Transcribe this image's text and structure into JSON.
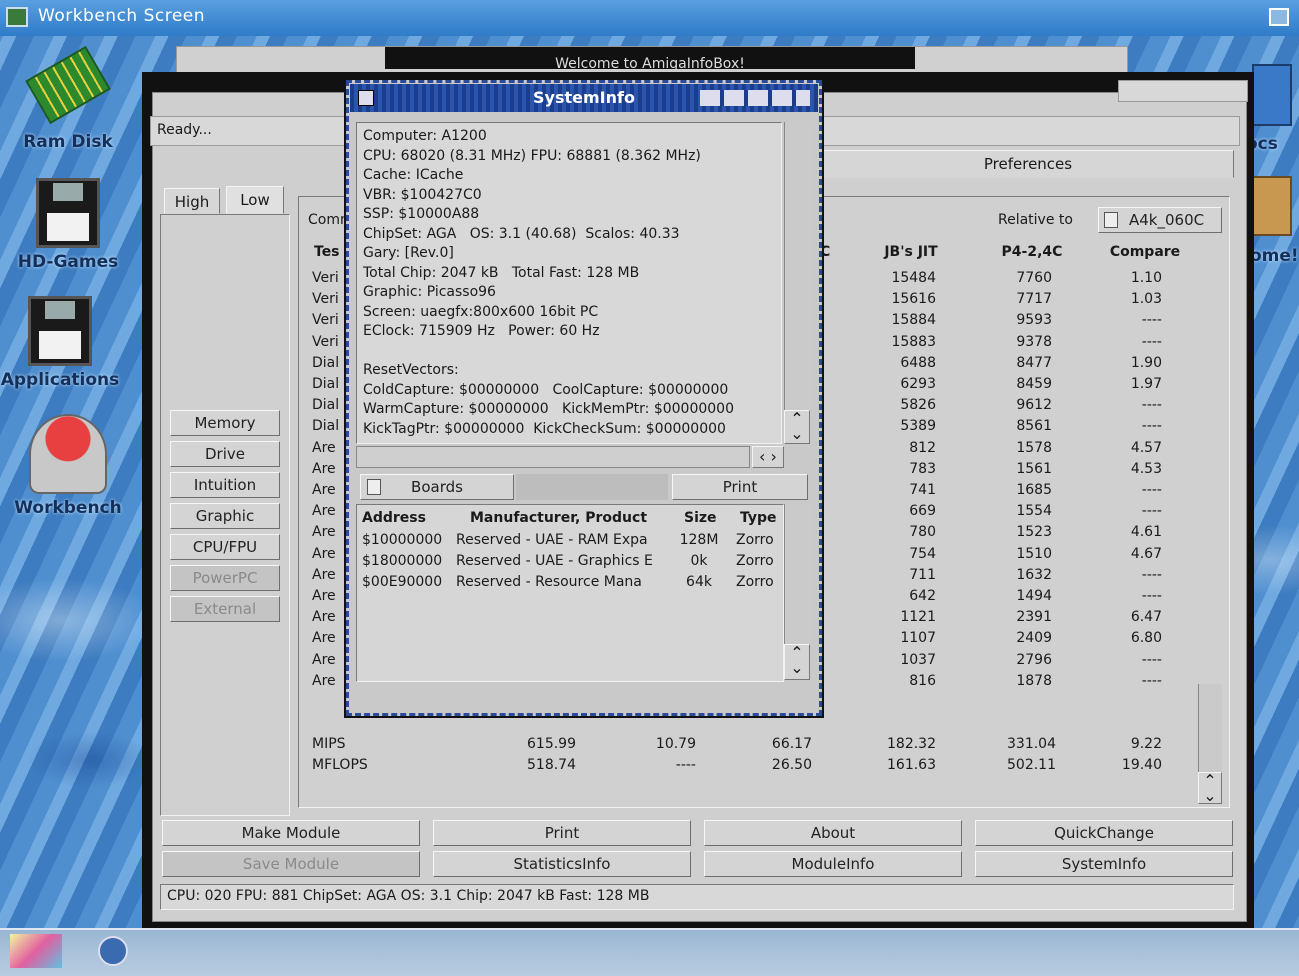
{
  "screen_title": "Workbench Screen",
  "desktop_icons": [
    {
      "label": "Ram Disk",
      "icon": "ram-chip-icon"
    },
    {
      "label": "HD-Games",
      "icon": "floppy-disk-icon"
    },
    {
      "label": "Applications",
      "icon": "floppy-disk-icon"
    },
    {
      "label": "Workbench",
      "icon": "workbench-icon"
    }
  ],
  "right_icons": {
    "docs": "ocs",
    "home": "ome!"
  },
  "back_title": "Welcome to AmigaInfoBox!",
  "main": {
    "status": "Ready...",
    "tabs": {
      "high": "High",
      "low": "Low",
      "preferences": "Preferences",
      "comment": "Comm"
    },
    "side_buttons": [
      "Memory",
      "Drive",
      "Intuition",
      "Graphic",
      "CPU/FPU",
      "PowerPC",
      "External"
    ],
    "relative_to": "Relative to",
    "relative_value": "A4k_060C",
    "col_headers": {
      "test": "Tes",
      "c": "C",
      "jit": "JB's JIT",
      "p4": "P4-2,4C",
      "compare": "Compare"
    },
    "rows": [
      {
        "name": "Veri",
        "jit": "15484",
        "p4": "7760",
        "cmp": "1.10"
      },
      {
        "name": "Veri",
        "jit": "15616",
        "p4": "7717",
        "cmp": "1.03"
      },
      {
        "name": "Veri",
        "jit": "15884",
        "p4": "9593",
        "cmp": "----"
      },
      {
        "name": "Veri",
        "jit": "15883",
        "p4": "9378",
        "cmp": "----"
      },
      {
        "name": "Dial",
        "jit": "6488",
        "p4": "8477",
        "cmp": "1.90"
      },
      {
        "name": "Dial",
        "jit": "6293",
        "p4": "8459",
        "cmp": "1.97"
      },
      {
        "name": "Dial",
        "jit": "5826",
        "p4": "9612",
        "cmp": "----"
      },
      {
        "name": "Dial",
        "jit": "5389",
        "p4": "8561",
        "cmp": "----"
      },
      {
        "name": "Are",
        "jit": "812",
        "p4": "1578",
        "cmp": "4.57"
      },
      {
        "name": "Are",
        "jit": "783",
        "p4": "1561",
        "cmp": "4.53"
      },
      {
        "name": "Are",
        "jit": "741",
        "p4": "1685",
        "cmp": "----"
      },
      {
        "name": "Are",
        "jit": "669",
        "p4": "1554",
        "cmp": "----"
      },
      {
        "name": "Are",
        "jit": "780",
        "p4": "1523",
        "cmp": "4.61"
      },
      {
        "name": "Are",
        "jit": "754",
        "p4": "1510",
        "cmp": "4.67"
      },
      {
        "name": "Are",
        "jit": "711",
        "p4": "1632",
        "cmp": "----"
      },
      {
        "name": "Are",
        "jit": "642",
        "p4": "1494",
        "cmp": "----"
      },
      {
        "name": "Are",
        "jit": "1121",
        "p4": "2391",
        "cmp": "6.47"
      },
      {
        "name": "Are",
        "jit": "1107",
        "p4": "2409",
        "cmp": "6.80"
      },
      {
        "name": "Are",
        "jit": "1037",
        "p4": "2796",
        "cmp": "----"
      },
      {
        "name": "Are",
        "jit": "816",
        "p4": "1878",
        "cmp": "----"
      }
    ],
    "summary": [
      {
        "name": "MIPS",
        "a": "615.99",
        "b": "10.79",
        "c": "66.17",
        "jit": "182.32",
        "p4": "331.04",
        "cmp": "9.22"
      },
      {
        "name": "MFLOPS",
        "a": "518.74",
        "b": "----",
        "c": "26.50",
        "jit": "161.63",
        "p4": "502.11",
        "cmp": "19.40"
      }
    ],
    "bottom_buttons": [
      [
        "Make Module",
        "Print",
        "About",
        "QuickChange"
      ],
      [
        "Save Module",
        "StatisticsInfo",
        "ModuleInfo",
        "SystemInfo"
      ]
    ],
    "status_bottom": "CPU: 020 FPU: 881 ChipSet: AGA OS: 3.1 Chip: 2047 kB Fast: 128 MB"
  },
  "sysinfo": {
    "title": "SystemInfo",
    "info_text": "Computer: A1200\nCPU: 68020 (8.31 MHz) FPU: 68881 (8.362 MHz)\nCache: ICache\nVBR: $100427C0\nSSP: $10000A88\nChipSet: AGA   OS: 3.1 (40.68)  Scalos: 40.33\nGary: [Rev.0]\nTotal Chip: 2047 kB   Total Fast: 128 MB\nGraphic: Picasso96\nScreen: uaegfx:800x600 16bit PC\nEClock: 715909 Hz   Power: 60 Hz\n\nResetVectors:\nColdCapture: $00000000   CoolCapture: $00000000\nWarmCapture: $00000000   KickMemPtr: $00000000\nKickTagPtr: $00000000  KickCheckSum: $00000000",
    "boards_label": "Boards",
    "print_label": "Print",
    "board_headers": {
      "address": "Address",
      "mfr": "Manufacturer, Product",
      "size": "Size",
      "type": "Type"
    },
    "boards": [
      {
        "address": "$10000000",
        "mfr": "Reserved - UAE - RAM Expa",
        "size": "128M",
        "type": "Zorro"
      },
      {
        "address": "$18000000",
        "mfr": "Reserved - UAE - Graphics E",
        "size": "0k",
        "type": "Zorro"
      },
      {
        "address": "$00E90000",
        "mfr": "Reserved - Resource Mana",
        "size": "64k",
        "type": "Zorro"
      }
    ]
  }
}
